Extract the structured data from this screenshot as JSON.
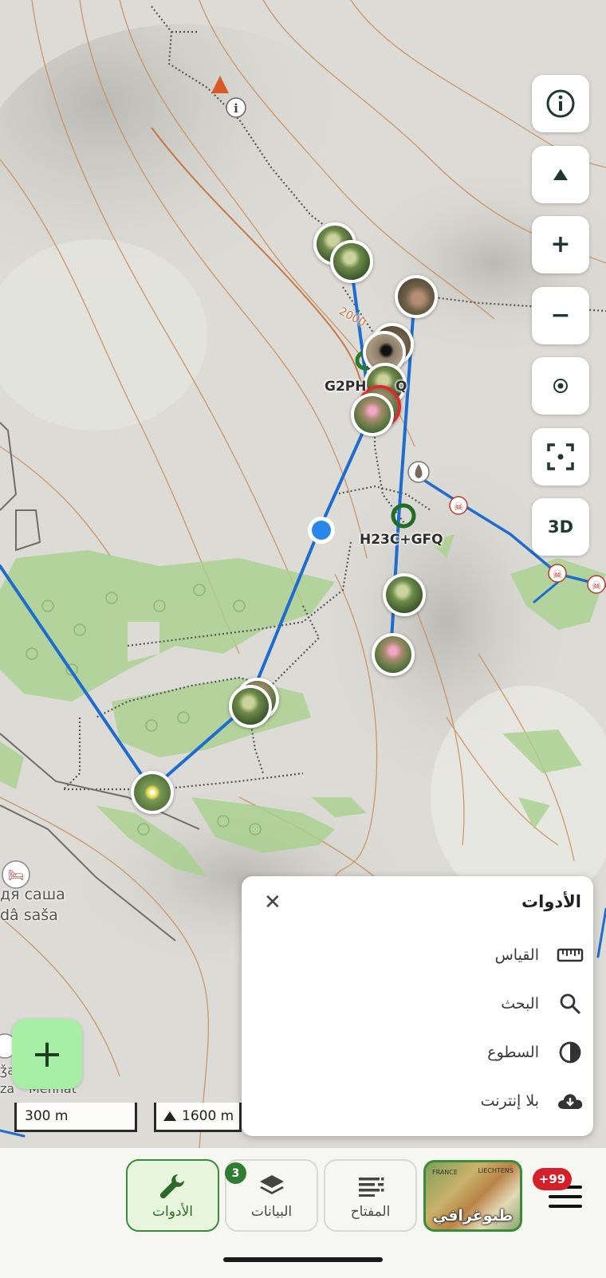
{
  "map": {
    "contour_label": "2000",
    "place_codes": [
      "G2PH",
      "Q",
      "H23C+GFQ"
    ],
    "place_name": [
      "дя саша",
      "dâ saša"
    ],
    "side_labels": [
      "ǯa",
      "za"
    ],
    "side_label2": "Mehnat",
    "photo_pins": [
      "grass",
      "bush",
      "flower",
      "pink",
      "beetle"
    ]
  },
  "controls": {
    "info_icon": "info-icon",
    "compass_icon": "north-arrow-icon",
    "zoom_in": "+",
    "zoom_out": "−",
    "locate_icon": "location-icon",
    "fullscreen_icon": "focus-frame-icon",
    "threed": "3D"
  },
  "scale": {
    "distance": "300 m",
    "elevation": "1600 m"
  },
  "tools_panel": {
    "title": "الأدوات",
    "close": "✕",
    "items": [
      {
        "label": "القياس",
        "icon": "ruler-icon"
      },
      {
        "label": "البحث",
        "icon": "search-icon"
      },
      {
        "label": "السطوع",
        "icon": "contrast-icon"
      },
      {
        "label": "بلا إنترنت",
        "icon": "cloud-download-icon"
      }
    ]
  },
  "bottom_nav": {
    "tools": "الأدوات",
    "data": "البيانات",
    "data_badge": "3",
    "legend": "المفتاح",
    "basemap": "طبوغرافي",
    "basemap_tiny": [
      "FRANCE",
      "LIECHTENS"
    ],
    "notifications": "+99"
  },
  "colors": {
    "route_blue": "#1e6ccf",
    "accent_green": "#2f7d32",
    "fab_green": "#a8efa6",
    "alert_red": "#d5202a"
  }
}
